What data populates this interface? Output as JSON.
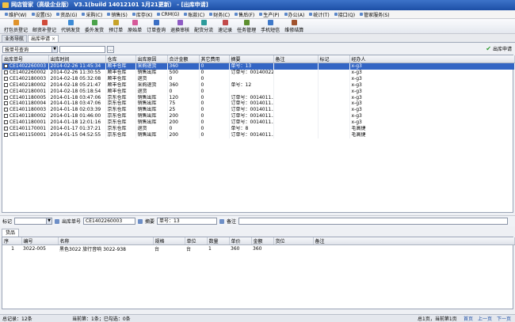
{
  "window": {
    "title": "网店管家（高级企业版） V3.1(build 14012101 1月21更新） - [出库申请]"
  },
  "menu": [
    "维护(W)",
    "设置(S)",
    "资品(G)",
    "采购(C)",
    "销售(S)",
    "库存(K)",
    "CRM(G)",
    "账款(C)",
    "财务(C)",
    "售后(F)",
    "生产(P)",
    "办公(A)",
    "统计(T)",
    "接口(Q)",
    "管家服务(S)"
  ],
  "toolbar": [
    "打包员登记",
    "邮资补登记",
    "代销发货",
    "委外发货",
    "预订单",
    "原始单",
    "订单查询",
    "退换审核",
    "配货分流",
    "速记录",
    "任务管理",
    "手机短信",
    "维修结算"
  ],
  "tabs": [
    {
      "label": "业务导航"
    },
    {
      "label": "出库申请"
    }
  ],
  "filter": {
    "mode": "按单号查询",
    "search_value": "",
    "out_button": "出库申请"
  },
  "grid": {
    "columns": [
      "出库单号",
      "出库时间",
      "仓库",
      "出库原因",
      "合计金额",
      "其它费用",
      "摘要",
      "备注",
      "标记",
      "经办人"
    ],
    "rows": [
      [
        "CE1402260003",
        "2014-02-26  11:45:34",
        "顺丰仓库",
        "采购退货",
        "360",
        "0",
        "单号：13",
        "",
        "",
        "x-g3"
      ],
      [
        "CE1402260002",
        "2014-02-26  11:30:55",
        "顺丰仓库",
        "销售出库",
        "500",
        "0",
        "订单号：00140022...",
        "",
        "",
        "x-g3"
      ],
      [
        "CE1402180003",
        "2014-02-18  05:32:08",
        "顺丰仓库",
        "退货",
        "0",
        "0",
        "",
        "",
        "",
        "x-g3"
      ],
      [
        "CE1402180002",
        "2014-02-18  05:21:47",
        "顺丰仓库",
        "采购退货",
        "360",
        "0",
        "单号：12",
        "",
        "",
        "x-g3"
      ],
      [
        "CE1402180001",
        "2014-02-18  05:18:54",
        "顺丰仓库",
        "退货",
        "0",
        "0",
        "",
        "",
        "",
        "x-g3"
      ],
      [
        "CE1401180005",
        "2014-01-18  03:47:06",
        "京东仓库",
        "销售出库",
        "120",
        "0",
        "订单号：0014011...",
        "",
        "",
        "x-g3"
      ],
      [
        "CE1401180004",
        "2014-01-18  03:47:06",
        "京东仓库",
        "销售出库",
        "75",
        "0",
        "订单号：0014011...",
        "",
        "",
        "x-g3"
      ],
      [
        "CE1401180003",
        "2014-01-18  02:03:39",
        "京东仓库",
        "销售出库",
        "25",
        "0",
        "订单号：0014011...",
        "",
        "",
        "x-g3"
      ],
      [
        "CE1401180002",
        "2014-01-18  01:46:00",
        "京东仓库",
        "销售出库",
        "200",
        "0",
        "订单号：0014011...",
        "",
        "",
        "x-g3"
      ],
      [
        "CE1401180001",
        "2014-01-18  12:01:16",
        "京东仓库",
        "销售出库",
        "200",
        "0",
        "订单号：0014011...",
        "",
        "",
        "x-g3"
      ],
      [
        "CE1401170001",
        "2014-01-17  01:37:21",
        "京东仓库",
        "退货",
        "0",
        "0",
        "单号：8",
        "",
        "",
        "毛高捷"
      ],
      [
        "CE1401150001",
        "2014-01-15  04:52:55",
        "京东仓库",
        "销售出库",
        "200",
        "0",
        "订单号：0014011...",
        "",
        "",
        "毛高捷"
      ]
    ]
  },
  "detail": {
    "mark_label": "标记",
    "out_no_label": "出库单号",
    "out_no": "CE1402260003",
    "summary_label": "摘要",
    "summary": "单号：13",
    "remark_label": "备注",
    "remark": ""
  },
  "goods": {
    "tab": "货品",
    "columns": [
      "序",
      "编号",
      "名称",
      "规格",
      "单位",
      "数量",
      "单价",
      "金额",
      "货位",
      "备注"
    ],
    "rows": [
      [
        "1",
        "3022-005",
        "黑色3022 旅行音响 3022-938",
        "台",
        "台",
        "1",
        "360",
        "360",
        "",
        ""
      ]
    ]
  },
  "status": {
    "total": "总记录：12条",
    "current": "当前第：1条；已勾选：0条",
    "page": "总1页，当前第1页",
    "first": "首页",
    "prev": "上一页",
    "next": "下一页"
  },
  "colors": {
    "title": "#1d4fa6",
    "selected": "#3365c4",
    "accent": "#2f9b2f"
  }
}
